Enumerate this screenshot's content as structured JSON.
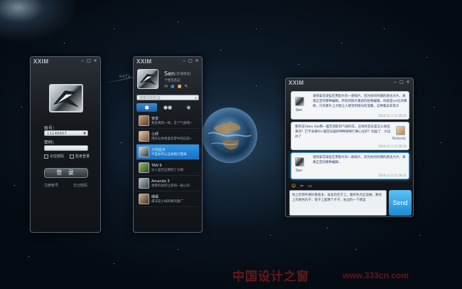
{
  "colors": {
    "accent": "#1d84d6",
    "bubble_highlight": "#3ea0ea",
    "send_button": "#2a9ae0"
  },
  "background": {
    "deco_text": "sofa"
  },
  "login_window": {
    "logo": "XXIM",
    "controls": [
      "‒",
      "□",
      "✕"
    ],
    "account_label": "账号：",
    "account_value": "11146667",
    "password_label": "密码：",
    "remember_label": "记住密码",
    "invisible_label": "隐身登录",
    "login_button": "登 录",
    "register_link": "注册帐号",
    "forgot_link": "忘记密码"
  },
  "contacts_window": {
    "logo": "XXIM",
    "controls": [
      "‒",
      "□",
      "✕"
    ],
    "user_name": "Sen",
    "user_status": "[在线状态]",
    "user_signature": "个性签名这",
    "search_placeholder": "搜索你的好友",
    "tab_icons": [
      "person-icon",
      "group-icon",
      "recent-icon"
    ],
    "contacts": [
      {
        "name": "安安",
        "signature": "我多喝到一样，走个气质啊~",
        "selected": false
      },
      {
        "name": "小妤",
        "signature": "用的与你更喜欢梦中的这段~",
        "selected": false
      },
      {
        "name": "分情蓝天",
        "signature": "不是你可以这样我只需来",
        "selected": true
      },
      {
        "name": "TAN 9",
        "signature": "达人是否这期到了大啊",
        "selected": false
      },
      {
        "name": "Amanda 3",
        "signature": "想要的如何让影响一般心吗",
        "selected": false
      },
      {
        "name": "晴缘",
        "signature": "最非是小妹和要的路厂",
        "selected": false
      }
    ]
  },
  "chat_window": {
    "logo": "XXIM",
    "controls": [
      "‒",
      "□",
      "✕"
    ],
    "messages": [
      {
        "sender": "Sen",
        "text": "请到拿花梁挂在用影片的一款照片，因为你的时期的感光大片，真真正定的那种编辑，所有的照片集结的给物编辑，你就是ice比的哪样，只有那片上才能让人感觉到阳光的温暖，这种集异非常大",
        "time": "2010-11-2 11:36:24",
        "highlight": false
      },
      {
        "sender": "Nobody",
        "text": "我带志Fabio Vaz看一面无调影的气质的车，这样的音乐是怎么进出来的？它不净来吗+尾空乐器的种种那样们事心化护？别血了：大设孙了",
        "time": "2010-11-2 11:36:26",
        "highlight": false
      },
      {
        "sender": "Sen",
        "text": "请到拿花梁挂在用影片的一款照片，因为你的时期的感光大片，真真正定的那种编辑...",
        "time": "2010-11-2 11:36:31",
        "highlight": true
      }
    ],
    "input_text": "地上的原件要好看很多，既会的佳子上，最终色点应该做，算地上的黄色的子，夜子上面两个子子，右边的一个哪里",
    "send_label": "Send",
    "toolbar_icons": [
      "smiley-icon",
      "scissors-icon",
      "screen-icon"
    ]
  },
  "watermark": {
    "cn": "中国设计之窗",
    "url": "www.333cn.com"
  }
}
